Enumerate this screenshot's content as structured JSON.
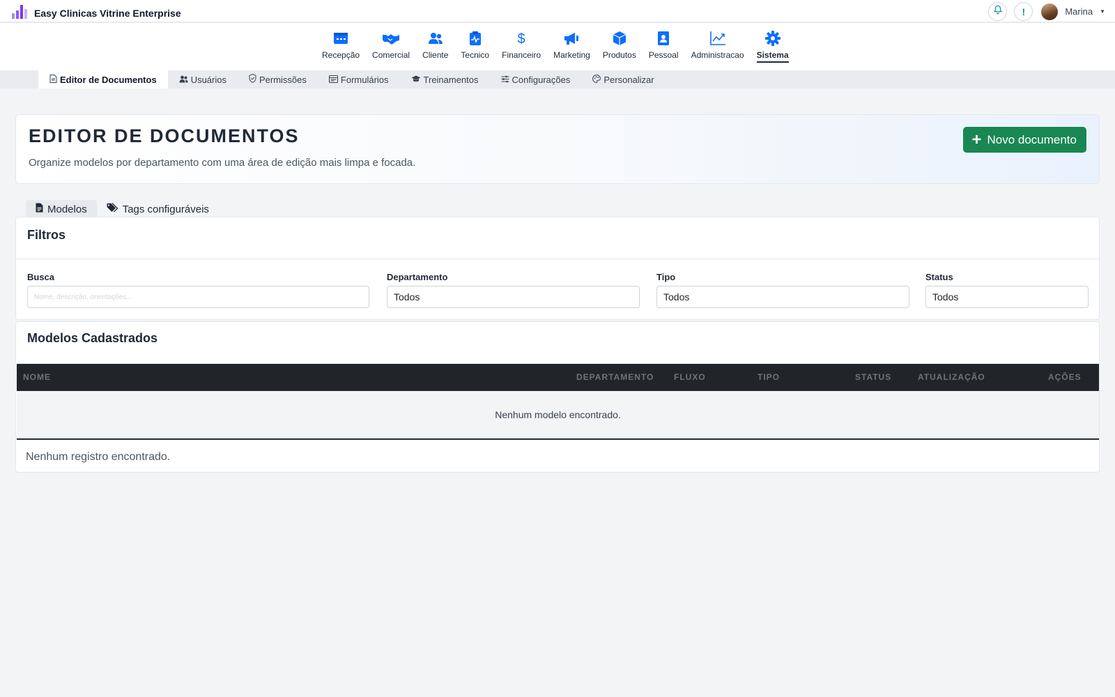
{
  "app": {
    "title": "Easy Clinicas Vitrine Enterprise",
    "user_name": "Marina",
    "alert_symbol": "!"
  },
  "modules": [
    {
      "label": "Recepção",
      "icon": "reception-icon"
    },
    {
      "label": "Comercial",
      "icon": "handshake-icon"
    },
    {
      "label": "Cliente",
      "icon": "users-icon"
    },
    {
      "label": "Tecnico",
      "icon": "clipboard-pulse-icon"
    },
    {
      "label": "Financeiro",
      "icon": "dollar-icon"
    },
    {
      "label": "Marketing",
      "icon": "megaphone-icon"
    },
    {
      "label": "Produtos",
      "icon": "box-icon"
    },
    {
      "label": "Pessoal",
      "icon": "id-badge-icon"
    },
    {
      "label": "Administracao",
      "icon": "chart-line-icon"
    },
    {
      "label": "Sistema",
      "icon": "gear-icon",
      "active": true
    }
  ],
  "subnav": [
    {
      "label": "Editor de Documentos",
      "active": true
    },
    {
      "label": "Usuários"
    },
    {
      "label": "Permissões"
    },
    {
      "label": "Formulários"
    },
    {
      "label": "Treinamentos"
    },
    {
      "label": "Configurações"
    },
    {
      "label": "Personalizar"
    }
  ],
  "header": {
    "title": "EDITOR DE DOCUMENTOS",
    "subtitle": "Organize modelos por departamento com uma área de edição mais limpa e focada.",
    "new_button": "Novo documento"
  },
  "tabs": [
    {
      "label": "Modelos",
      "active": true
    },
    {
      "label": "Tags configuráveis"
    }
  ],
  "filters": {
    "title": "Filtros",
    "search_label": "Busca",
    "search_placeholder": "Nome, descrição, orientações...",
    "department_label": "Departamento",
    "department_value": "Todos",
    "type_label": "Tipo",
    "type_value": "Todos",
    "status_label": "Status",
    "status_value": "Todos"
  },
  "models": {
    "title": "Modelos Cadastrados",
    "columns": [
      "NOME",
      "DEPARTAMENTO",
      "FLUXO",
      "TIPO",
      "STATUS",
      "ATUALIZAÇÃO",
      "AÇÕES"
    ],
    "empty_message": "Nenhum modelo encontrado.",
    "footer": "Nenhum registro encontrado."
  },
  "colors": {
    "accent": "#0d6efd",
    "primary_button": "#198754",
    "table_header": "#212529",
    "brand": "#8b5cf6"
  }
}
